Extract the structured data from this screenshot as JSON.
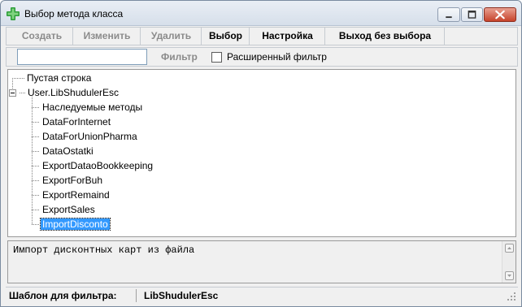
{
  "window": {
    "title": "Выбор метода класса",
    "icon": "green-plus-icon"
  },
  "toolbar": {
    "buttons": [
      {
        "label": "Создать",
        "enabled": false
      },
      {
        "label": "Изменить",
        "enabled": false
      },
      {
        "label": "Удалить",
        "enabled": false
      },
      {
        "label": "Выбор",
        "enabled": true
      },
      {
        "label": "Настройка",
        "enabled": true
      },
      {
        "label": "Выход без выбора",
        "enabled": true
      }
    ]
  },
  "filter": {
    "value": "",
    "label": "Фильтр",
    "extended_label": "Расширенный фильтр",
    "extended_checked": false
  },
  "tree": {
    "items": [
      {
        "label": "Пустая строка",
        "level": 0
      },
      {
        "label": "User.LibShudulerEsc",
        "level": 0,
        "expanded": true
      },
      {
        "label": "Наследуемые методы",
        "level": 1
      },
      {
        "label": "DataForInternet",
        "level": 1
      },
      {
        "label": "DataForUnionPharma",
        "level": 1
      },
      {
        "label": "DataOstatki",
        "level": 1
      },
      {
        "label": "ExportDataoBookkeeping",
        "level": 1
      },
      {
        "label": "ExportForBuh",
        "level": 1
      },
      {
        "label": "ExportRemaind",
        "level": 1
      },
      {
        "label": "ExportSales",
        "level": 1
      },
      {
        "label": "ImportDisconto",
        "level": 1,
        "selected": true
      }
    ]
  },
  "description": {
    "text": "Импорт дисконтных карт из файла"
  },
  "status": {
    "label": "Шаблон для фильтра:",
    "value": "LibShudulerEsc"
  },
  "colors": {
    "selection": "#3399ff",
    "disabled_text": "#8b8b8b"
  }
}
